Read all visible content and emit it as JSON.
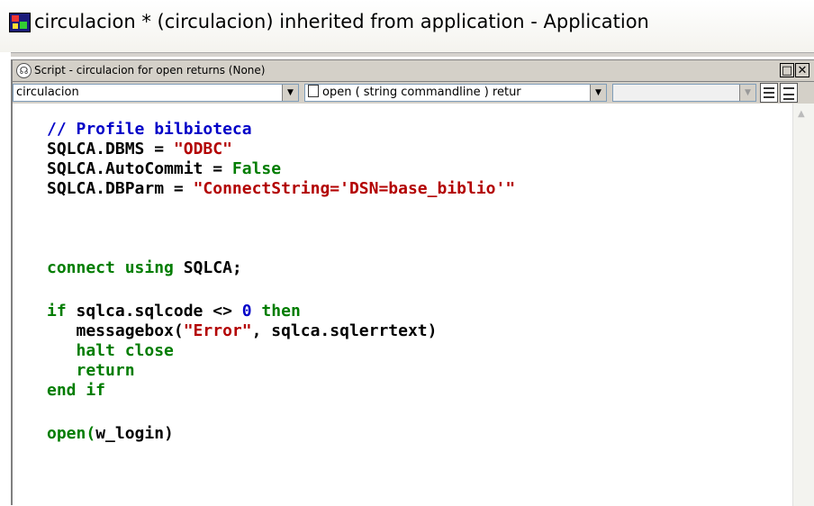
{
  "window": {
    "title": "circulacion * (circulacion) inherited from application - Application"
  },
  "script_window": {
    "title": "Script - circulacion for open returns (None)",
    "object_select": "circulacion",
    "event_select": "open ( string commandline ) retur",
    "third_select": ""
  },
  "icons": {
    "app": "powerbuilder-app-icon",
    "script": "script-icon",
    "event": "document-icon"
  },
  "code": {
    "line1": "// Profile bilbioteca",
    "line2a": "SQLCA.DBMS = ",
    "line2b": "\"ODBC\"",
    "line3a": "SQLCA.AutoCommit = ",
    "line3b": "False",
    "line4a": "SQLCA.DBParm = ",
    "line4b": "\"ConnectString='DSN=base_biblio'\"",
    "line5a": "connect using ",
    "line5b": "SQLCA;",
    "line6a": "if ",
    "line6b": "sqlca.sqlcode <> ",
    "line6c": "0",
    "line6d": " then",
    "line7a": "   messagebox(",
    "line7b": "\"Error\"",
    "line7c": ", sqlca.sqlerrtext)",
    "line8": "   halt close",
    "line9": "   return",
    "line10": "end if",
    "line11a": "open(",
    "line11b": "w_login)"
  },
  "colors": {
    "keyword": "#007d00",
    "string": "#b30000",
    "comment": "#0000c8"
  }
}
